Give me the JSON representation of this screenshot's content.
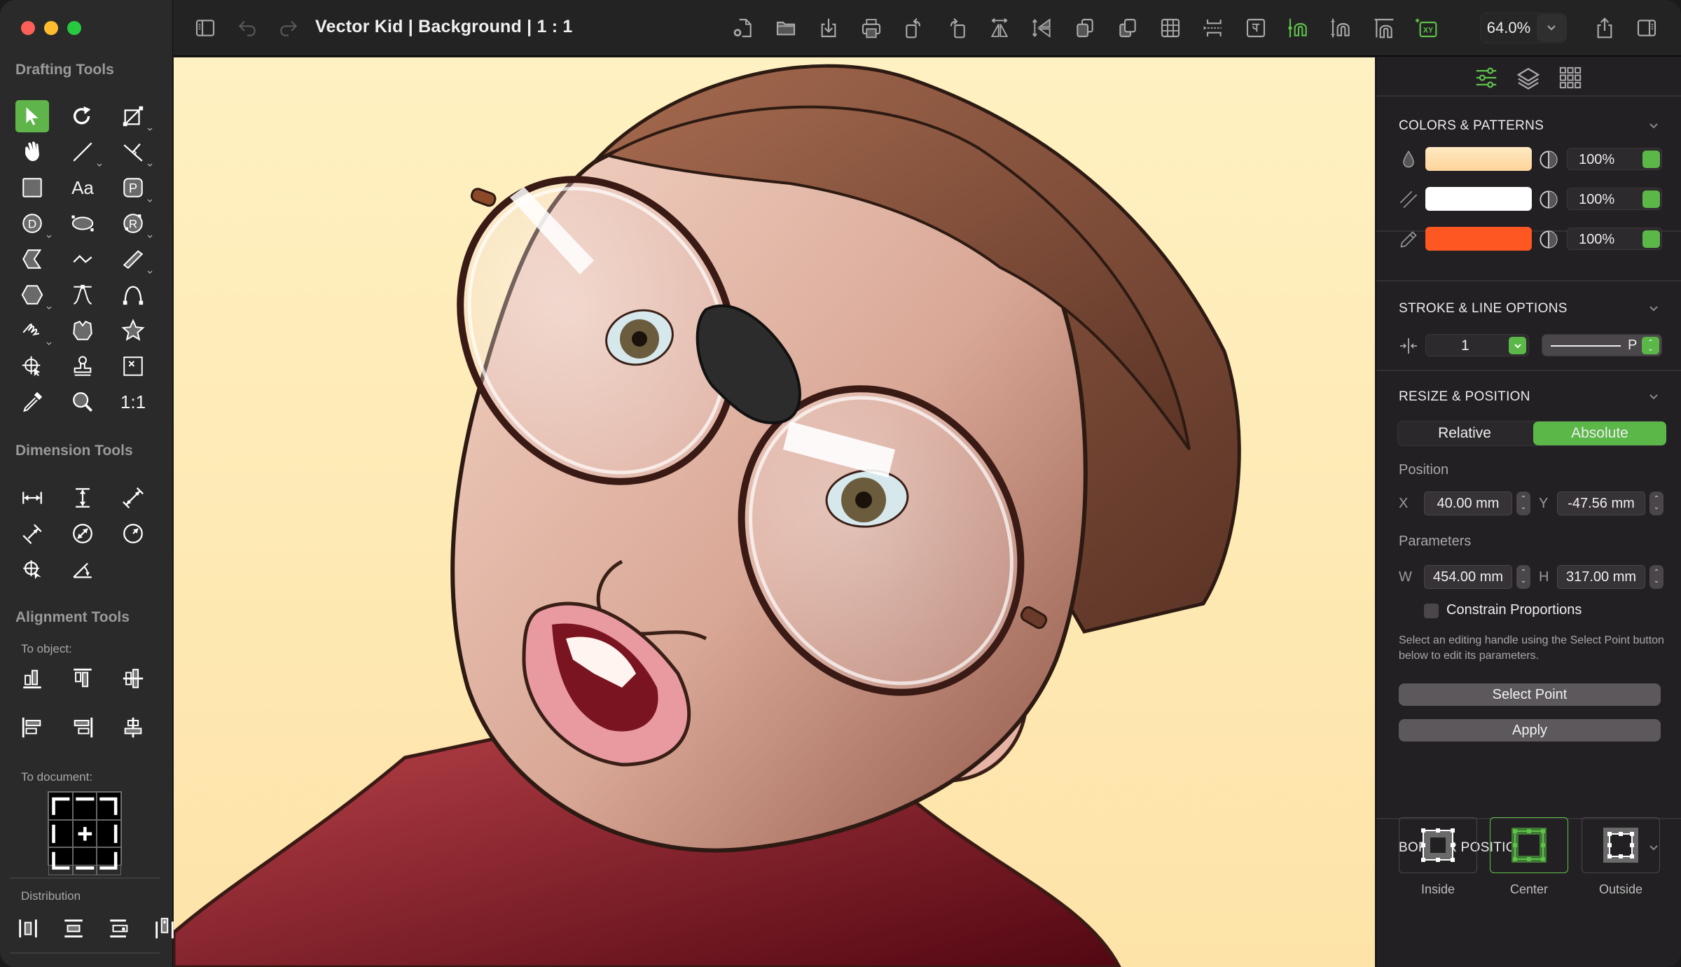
{
  "window": {
    "traffic_lights": [
      "#fe5f57",
      "#febc2e",
      "#28c840"
    ]
  },
  "toolbar": {
    "title": "Vector Kid | Background | 1 : 1",
    "zoom_level": "64.0%",
    "icons": [
      "sidebar-toggle-icon",
      "undo-icon",
      "redo-icon",
      "document-settings-icon",
      "open-folder-icon",
      "import-icon",
      "print-icon",
      "rotate-left-icon",
      "rotate-right-icon",
      "flip-horizontal-icon",
      "flip-vertical-icon",
      "bring-forward-icon",
      "send-backward-icon",
      "grid-icon",
      "snap-guides-icon",
      "text-frame-icon",
      "snap-magnet-icon",
      "snap-magnet-vertical-icon",
      "snap-magnet-edge-icon",
      "coordinates-xy-icon",
      "share-icon",
      "inspector-toggle-icon"
    ]
  },
  "sidebar": {
    "drafting_title": "Drafting Tools",
    "drafting_tools": [
      {
        "name": "select-tool",
        "active": true
      },
      {
        "name": "rotate-tool"
      },
      {
        "name": "crop-transform-tool"
      },
      {
        "name": "hand-pan-tool"
      },
      {
        "name": "line-tool"
      },
      {
        "name": "perpendicular-line-tool"
      },
      {
        "name": "rectangle-tool"
      },
      {
        "name": "text-tool",
        "text": "Aa"
      },
      {
        "name": "placeholder-tool",
        "text": "P"
      },
      {
        "name": "diameter-circle-tool",
        "text": "D"
      },
      {
        "name": "ellipse-tool"
      },
      {
        "name": "radius-circle-tool",
        "text": "R"
      },
      {
        "name": "arrow-shape-tool"
      },
      {
        "name": "polyline-tool"
      },
      {
        "name": "double-line-tool"
      },
      {
        "name": "polygon-tool"
      },
      {
        "name": "bezier-tool"
      },
      {
        "name": "arc-tool"
      },
      {
        "name": "freehand-tool"
      },
      {
        "name": "custom-shape-tool"
      },
      {
        "name": "star-tool"
      },
      {
        "name": "point-select-tool"
      },
      {
        "name": "stamp-tool"
      },
      {
        "name": "image-frame-tool"
      },
      {
        "name": "eyedropper-tool"
      },
      {
        "name": "zoom-tool"
      },
      {
        "name": "actual-size-tool",
        "text": "1:1"
      }
    ],
    "dimension_title": "Dimension Tools",
    "dimension_tools": [
      "horizontal-dimension-tool",
      "vertical-dimension-tool",
      "aligned-dimension-tool",
      "perpendicular-dimension-tool",
      "diameter-dimension-tool",
      "radius-dimension-tool",
      "point-dimension-tool",
      "angle-dimension-tool"
    ],
    "alignment_title": "Alignment Tools",
    "to_object_label": "To object:",
    "to_object_tools": [
      "align-bottom-icon",
      "align-top-icon",
      "align-middle-vertical-icon",
      "align-left-icon",
      "align-right-icon",
      "align-center-horizontal-icon"
    ],
    "to_document_label": "To document:",
    "distribution_label": "Distribution",
    "distribution_tools": [
      "distribute-horizontal-icon",
      "distribute-vertical-center-icon",
      "distribute-vertical-right-icon",
      "distribute-horizontal-top-icon"
    ]
  },
  "panel": {
    "tabs": [
      "inspector-sliders-icon",
      "layers-icon",
      "library-grid-icon"
    ],
    "colors": {
      "title": "COLORS & PATTERNS",
      "rows": [
        {
          "type": "fill",
          "icon": "fill-drop-icon",
          "color": "#fdd9a4",
          "opacity": "100%"
        },
        {
          "type": "hatch",
          "icon": "hatch-pattern-icon",
          "color": "#ffffff",
          "opacity": "100%"
        },
        {
          "type": "stroke",
          "icon": "pencil-stroke-icon",
          "color": "#ff5722",
          "opacity": "100%"
        }
      ]
    },
    "stroke": {
      "title": "STROKE & LINE OPTIONS",
      "width": "1",
      "line_style_label": "P"
    },
    "resize": {
      "title": "RESIZE & POSITION",
      "modes": [
        "Relative",
        "Absolute"
      ],
      "active_mode": "Absolute",
      "position_label": "Position",
      "x_label": "X",
      "x": "40.00 mm",
      "y_label": "Y",
      "y": "-47.56 mm",
      "parameters_label": "Parameters",
      "w_label": "W",
      "w": "454.00 mm",
      "h_label": "H",
      "h": "317.00 mm",
      "constrain_label": "Constrain Proportions",
      "constrain_checked": false,
      "hint": "Select an editing handle using the Select Point button below to edit its parameters.",
      "select_point": "Select Point",
      "apply": "Apply"
    },
    "border": {
      "title": "BORDER POSITION",
      "options": [
        "Inside",
        "Center",
        "Outside"
      ],
      "active": "Center"
    }
  },
  "canvas": {
    "artwork": "Vector illustration of a boy with large glasses taped at the bridge, mouth open, red sweater",
    "background_top": "#fff1c2",
    "background_bottom": "#fde3a8"
  }
}
